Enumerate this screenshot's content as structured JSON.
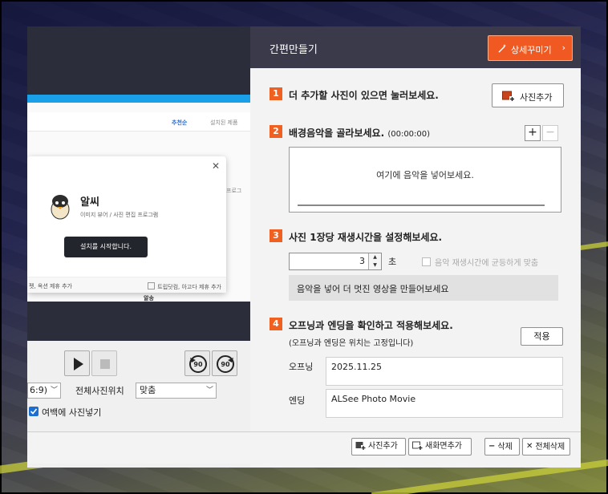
{
  "preview": {
    "sort_label": "추천순",
    "tab_label": "설치된 제품",
    "side_text": "프로그",
    "dialog": {
      "app_name": "알씨",
      "app_desc": "이미지 뷰어 / 사진 편집 프로그램",
      "install_button": "설치를 시작합니다.",
      "footer_left": "펫, 옥션 제휴 추가",
      "footer_right": "트립닷컴, 아고다 제휴 추가"
    },
    "behind_text": "알송"
  },
  "controls": {
    "play_label": "▶",
    "rewind_label": "90",
    "forward_label": "90",
    "aspect_value": "6:9)",
    "position_label": "전체사진위치",
    "position_value": "맞춤",
    "margin_checkbox_label": "여백에 사진넣기",
    "margin_checked": true
  },
  "panel": {
    "title": "간편만들기",
    "detail_button": "상세꾸미기",
    "steps": [
      {
        "num": "1",
        "text": "더 추가할 사진이 있으면 눌러보세요."
      },
      {
        "num": "2",
        "text": "배경음악을 골라보세요.",
        "sub": "(00:00:00)"
      },
      {
        "num": "3",
        "text": "사진 1장당 재생시간을 설정해보세요."
      },
      {
        "num": "4",
        "text": "오프닝과 엔딩을 확인하고 적용해보세요.",
        "sub": "(오프닝과 엔딩은 위치는 고정입니다)"
      }
    ],
    "add_photo_button": "사진추가",
    "music_placeholder": "여기에 음악을 넣어보세요.",
    "plus_label": "+",
    "minus_label": "−",
    "duration_value": "3",
    "duration_unit": "초",
    "even_label": "음악 재생시간에 균등하게 맞춤",
    "note": "음악을 넣어 더 멋진 영상을 만들어보세요",
    "apply_button": "적용",
    "opening_label": "오프닝",
    "opening_value": "2025.11.25",
    "ending_label": "엔딩",
    "ending_value": "ALSee Photo Movie"
  },
  "bottom": {
    "add_photo": "사진추가",
    "new_screen": "새화면추가",
    "delete": "삭제",
    "delete_all": "전체삭제"
  },
  "colors": {
    "accent": "#f06020",
    "header_bg": "#3a3a4b",
    "checkbox": "#1b6fd1"
  }
}
